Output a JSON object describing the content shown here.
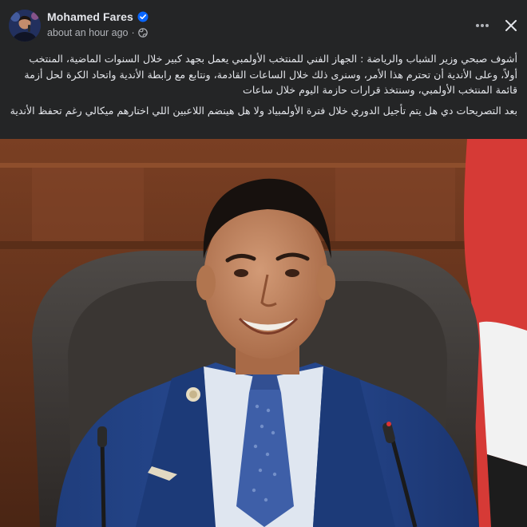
{
  "post": {
    "author": "Mohamed Fares",
    "verified_icon": "verified-badge-icon",
    "timestamp": "about an hour ago",
    "separator": "·",
    "audience_icon": "globe-icon",
    "more_icon": "more-options-icon",
    "close_icon": "close-icon",
    "paragraphs": [
      "أشوف صبحي وزير الشباب والرياضة : الجهاز الفني للمنتخب الأولمبي يعمل بجهد كبير خلال السنوات الماضية، المنتخب أولاً، وعلى الأندية أن تحترم هذا الأمر، وسنرى ذلك خلال الساعات القادمة، ونتابع مع رابطة الأندية واتحاد الكرة لحل أزمة قائمة المنتخب الأولمبي، وسنتخذ قرارات حازمة اليوم خلال ساعات",
      "بعد التصريحات دي هل يتم تأجيل الدوري خلال فترة الأولمبياد ولا هل هينضم اللاعبين اللي اختارهم ميكالي رغم تحفظ الأندية"
    ]
  },
  "colors": {
    "card_bg": "#242526",
    "primary_text": "#e4e6eb",
    "secondary_text": "#b0b3b8",
    "verified_blue": "#0866ff"
  }
}
